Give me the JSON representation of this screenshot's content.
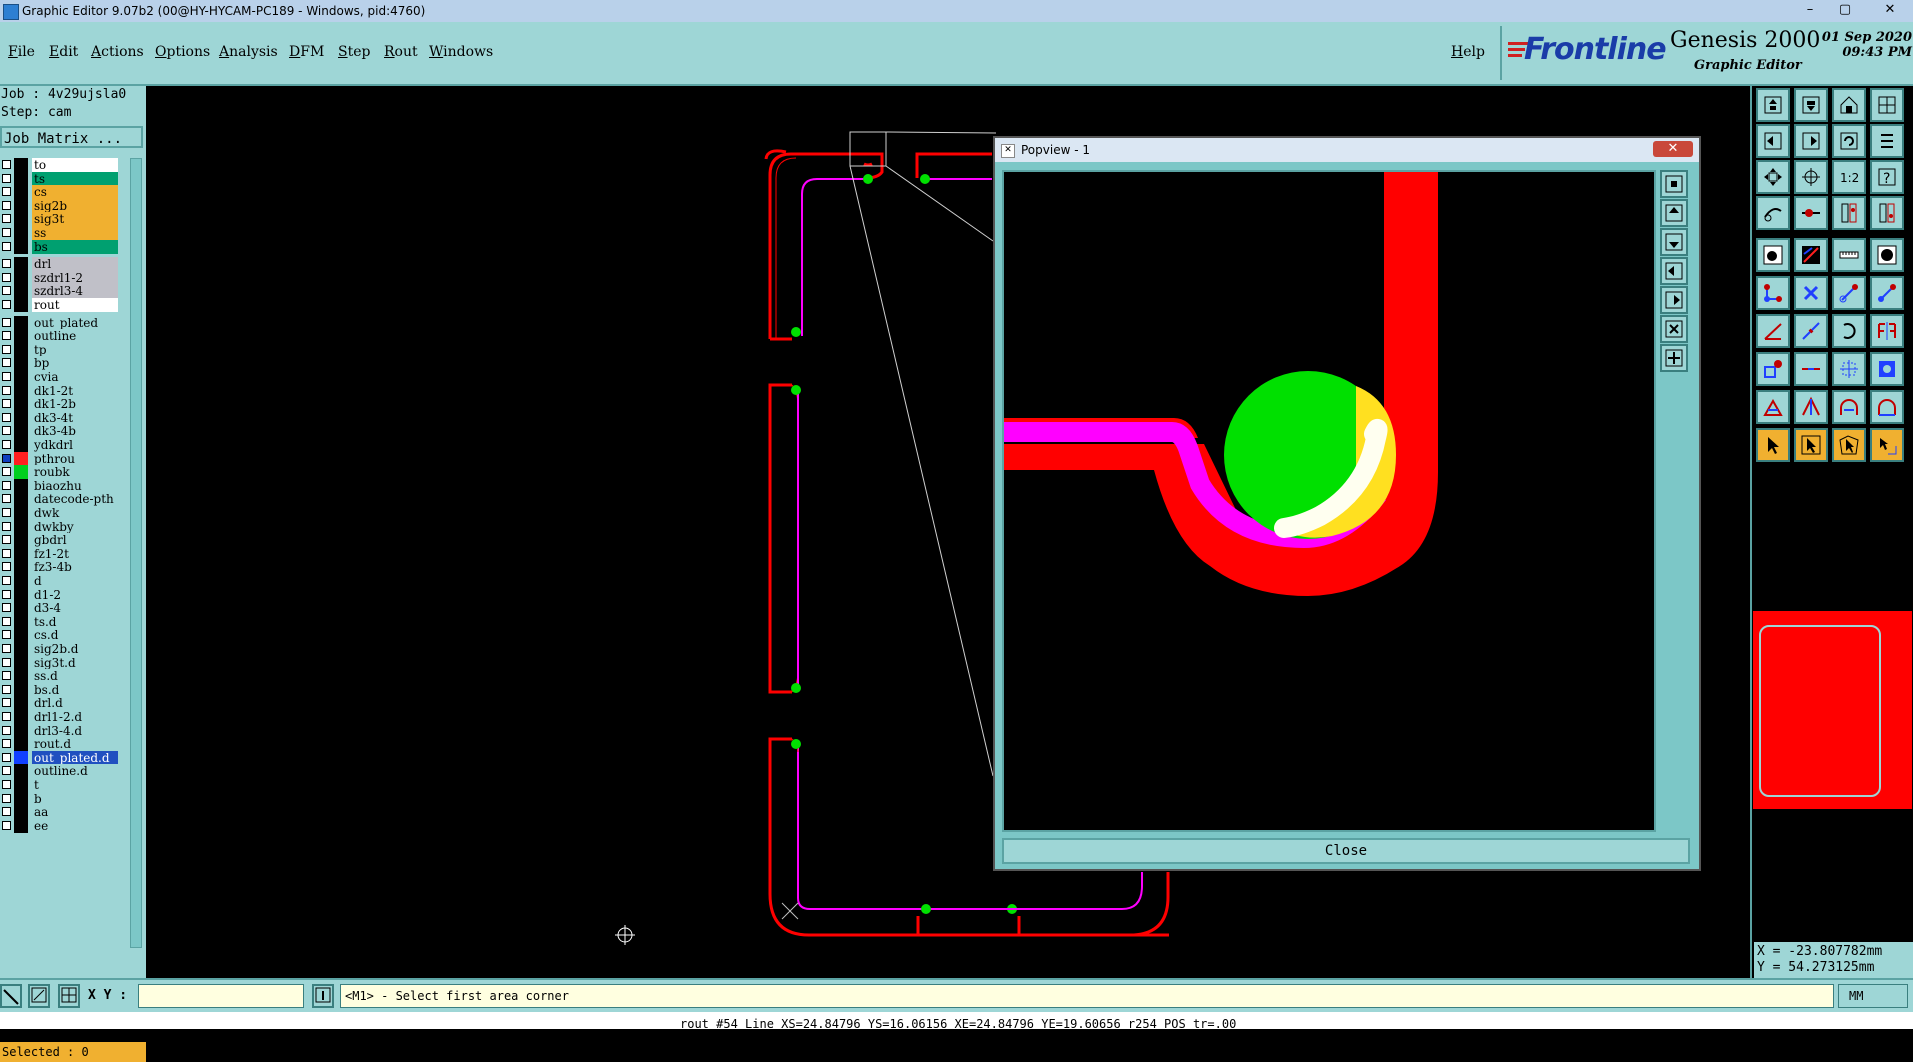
{
  "window": {
    "title": "Graphic Editor 9.07b2 (00@HY-HYCAM-PC189 - Windows, pid:4760)",
    "min": "–",
    "max": "▢",
    "close": "✕"
  },
  "menu": {
    "items": [
      "File",
      "Edit",
      "Actions",
      "Options",
      "Analysis",
      "DFM",
      "Step",
      "Rout",
      "Windows"
    ],
    "help": "Help"
  },
  "branding": {
    "logo": "Frontline",
    "product": "Genesis 2000",
    "subtitle": "Graphic Editor",
    "date": "01 Sep 2020",
    "time": "09:43 PM"
  },
  "job": {
    "job_line": "Job : 4v29ujsla0",
    "step_line": "Step: cam",
    "matrix_button": "Job Matrix ..."
  },
  "layers": [
    {
      "name": "to",
      "style": "white"
    },
    {
      "name": "ts",
      "style": "green"
    },
    {
      "name": "cs",
      "style": "orange"
    },
    {
      "name": "sig2b",
      "style": "orange"
    },
    {
      "name": "sig3t",
      "style": "orange"
    },
    {
      "name": "ss",
      "style": "orange"
    },
    {
      "name": "bs",
      "style": "green"
    },
    {
      "name": "drl",
      "style": "gray"
    },
    {
      "name": "szdrl1-2",
      "style": "gray"
    },
    {
      "name": "szdrl3-4",
      "style": "gray"
    },
    {
      "name": "rout",
      "style": "white"
    },
    {
      "name": "out_plated",
      "style": "cyan"
    },
    {
      "name": "outline",
      "style": "cyan"
    },
    {
      "name": "tp",
      "style": "cyan"
    },
    {
      "name": "bp",
      "style": "cyan"
    },
    {
      "name": "cvia",
      "style": "cyan"
    },
    {
      "name": "dk1-2t",
      "style": "cyan"
    },
    {
      "name": "dk1-2b",
      "style": "cyan"
    },
    {
      "name": "dk3-4t",
      "style": "cyan"
    },
    {
      "name": "dk3-4b",
      "style": "cyan"
    },
    {
      "name": "ydkdrl",
      "style": "cyan"
    },
    {
      "name": "pthrou",
      "style": "cyan",
      "swatch": "#ff2020",
      "box": "#1040c0"
    },
    {
      "name": "roubk",
      "style": "cyan",
      "swatch": "#00d020"
    },
    {
      "name": "biaozhu",
      "style": "cyan"
    },
    {
      "name": "datecode-pth",
      "style": "cyan"
    },
    {
      "name": "dwk",
      "style": "cyan"
    },
    {
      "name": "dwkby",
      "style": "cyan"
    },
    {
      "name": "gbdrl",
      "style": "cyan"
    },
    {
      "name": "fz1-2t",
      "style": "cyan"
    },
    {
      "name": "fz3-4b",
      "style": "cyan"
    },
    {
      "name": "d",
      "style": "cyan"
    },
    {
      "name": "d1-2",
      "style": "cyan"
    },
    {
      "name": "d3-4",
      "style": "cyan"
    },
    {
      "name": "ts.d",
      "style": "cyan"
    },
    {
      "name": "cs.d",
      "style": "cyan"
    },
    {
      "name": "sig2b.d",
      "style": "cyan"
    },
    {
      "name": "sig3t.d",
      "style": "cyan"
    },
    {
      "name": "ss.d",
      "style": "cyan"
    },
    {
      "name": "bs.d",
      "style": "cyan"
    },
    {
      "name": "drl.d",
      "style": "cyan"
    },
    {
      "name": "drl1-2.d",
      "style": "cyan"
    },
    {
      "name": "drl3-4.d",
      "style": "cyan"
    },
    {
      "name": "rout.d",
      "style": "cyan"
    },
    {
      "name": "out_plated.d",
      "style": "blue",
      "swatch": "#1040ff"
    },
    {
      "name": "outline.d",
      "style": "cyan"
    },
    {
      "name": "t",
      "style": "cyan"
    },
    {
      "name": "b",
      "style": "cyan"
    },
    {
      "name": "aa",
      "style": "cyan"
    },
    {
      "name": "ee",
      "style": "cyan"
    }
  ],
  "selected": "Selected : 0",
  "popview": {
    "title": "Popview - 1",
    "close_button": "Close"
  },
  "coords": {
    "x": "X = -23.807782mm",
    "y": "Y =  54.273125mm"
  },
  "bottom": {
    "xy_label": "X Y :",
    "prompt": "<M1> - Select first area corner",
    "units": "MM"
  },
  "status": "rout #54 Line XS=24.84796 YS=16.06156 XE=24.84796 YE=19.60656 r254 POS tr=.00"
}
